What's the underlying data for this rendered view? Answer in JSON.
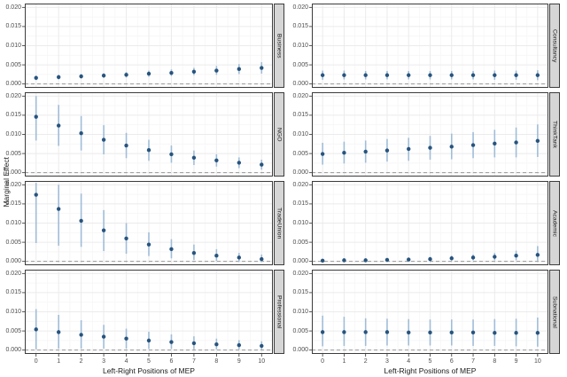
{
  "figure": {
    "y_axis_title": "Marginal Effect",
    "x_axis_title": "Left-Right Positions of MEP",
    "colors": {
      "point": "#27547e",
      "error_bar": "#a0bdd8",
      "strip_bg": "#d6d6d6",
      "panel_border": "#3c3c3c",
      "grid_major": "#ebebeb",
      "grid_minor": "#f6f6f6",
      "zero_line": "#999999",
      "tick_mark": "#333333"
    }
  },
  "chart_data": {
    "type": "scatter",
    "title": "",
    "xlabel": "Left-Right Positions of MEP",
    "ylabel": "Marginal Effect",
    "x": [
      0,
      1,
      2,
      3,
      4,
      5,
      6,
      7,
      8,
      9,
      10
    ],
    "x_tick_labels": [
      "0",
      "1",
      "2",
      "3",
      "4",
      "5",
      "6",
      "7",
      "8",
      "9",
      "10"
    ],
    "xlim": [
      -0.5,
      10.5
    ],
    "ylim": [
      -0.001,
      0.021
    ],
    "y_ticks": [
      0.0,
      0.005,
      0.01,
      0.015,
      0.02
    ],
    "y_tick_labels": [
      "0.000",
      "0.005",
      "0.010",
      "0.015",
      "0.020"
    ],
    "y_minor_ticks": [
      0.0025,
      0.0075,
      0.0125,
      0.0175
    ],
    "zero_line": 0,
    "grid": true,
    "legend": "none",
    "layout": "facet-grid 4 rows x 2 cols, strip labels on right of each panel",
    "facets": [
      {
        "name": "Business",
        "row": 0,
        "col": 0,
        "est": [
          0.0016,
          0.0018,
          0.002,
          0.0022,
          0.0024,
          0.0027,
          0.0029,
          0.0032,
          0.0035,
          0.0039,
          0.0042
        ],
        "lo": [
          0.001,
          0.0012,
          0.0014,
          0.0016,
          0.0017,
          0.0019,
          0.0021,
          0.0023,
          0.0024,
          0.0026,
          0.0027
        ],
        "hi": [
          0.0022,
          0.0024,
          0.0026,
          0.0028,
          0.0031,
          0.0035,
          0.0038,
          0.0042,
          0.0047,
          0.0052,
          0.0057
        ]
      },
      {
        "name": "Consultancy",
        "row": 0,
        "col": 1,
        "est": [
          0.0023,
          0.0023,
          0.0023,
          0.0023,
          0.0023,
          0.0023,
          0.0023,
          0.0023,
          0.0023,
          0.0023,
          0.0023
        ],
        "lo": [
          0.0011,
          0.0012,
          0.0012,
          0.0012,
          0.0012,
          0.0012,
          0.0012,
          0.0012,
          0.0011,
          0.0011,
          0.001
        ],
        "hi": [
          0.0035,
          0.0035,
          0.0034,
          0.0034,
          0.0034,
          0.0034,
          0.0034,
          0.0034,
          0.0035,
          0.0035,
          0.0036
        ]
      },
      {
        "name": "NGO",
        "row": 1,
        "col": 0,
        "est": [
          0.0146,
          0.0123,
          0.0103,
          0.0086,
          0.0071,
          0.0059,
          0.0048,
          0.0039,
          0.0032,
          0.0026,
          0.0021
        ],
        "lo": [
          0.0084,
          0.007,
          0.0058,
          0.0048,
          0.0038,
          0.0031,
          0.0026,
          0.002,
          0.0016,
          0.0012,
          0.0008
        ],
        "hi": [
          0.02,
          0.0177,
          0.0148,
          0.0124,
          0.0104,
          0.0086,
          0.0071,
          0.0058,
          0.0048,
          0.004,
          0.0034
        ]
      },
      {
        "name": "ThinkTank",
        "row": 1,
        "col": 1,
        "est": [
          0.0049,
          0.0052,
          0.0055,
          0.0058,
          0.0062,
          0.0065,
          0.0068,
          0.0072,
          0.0076,
          0.0079,
          0.0083
        ],
        "lo": [
          0.0021,
          0.0024,
          0.0026,
          0.0029,
          0.0031,
          0.0034,
          0.0035,
          0.0038,
          0.004,
          0.004,
          0.0041
        ],
        "hi": [
          0.0078,
          0.0081,
          0.0084,
          0.0088,
          0.0091,
          0.0096,
          0.0102,
          0.0106,
          0.0112,
          0.0118,
          0.0126
        ]
      },
      {
        "name": "TradeUnion",
        "row": 2,
        "col": 0,
        "est": [
          0.0174,
          0.0137,
          0.0106,
          0.0081,
          0.006,
          0.0044,
          0.0032,
          0.0022,
          0.0015,
          0.001,
          0.0006
        ],
        "lo": [
          0.0048,
          0.0041,
          0.0038,
          0.0027,
          0.002,
          0.0014,
          0.0008,
          0.0004,
          0.0001,
          0.0,
          -0.0001
        ],
        "hi": [
          0.0205,
          0.02,
          0.0177,
          0.0134,
          0.01,
          0.0076,
          0.0058,
          0.0044,
          0.0032,
          0.0022,
          0.0018
        ]
      },
      {
        "name": "Academic",
        "row": 2,
        "col": 1,
        "est": [
          0.0002,
          0.0003,
          0.0003,
          0.0004,
          0.0005,
          0.0006,
          0.0008,
          0.001,
          0.0012,
          0.0015,
          0.0017
        ],
        "lo": [
          0.0,
          0.0001,
          0.0001,
          0.0001,
          0.0001,
          0.0002,
          0.0002,
          0.0003,
          0.0003,
          0.0003,
          0.0002
        ],
        "hi": [
          0.0005,
          0.0006,
          0.0007,
          0.0008,
          0.001,
          0.0012,
          0.0015,
          0.0018,
          0.0022,
          0.0028,
          0.004
        ]
      },
      {
        "name": "Professional",
        "row": 3,
        "col": 0,
        "est": [
          0.0054,
          0.0047,
          0.004,
          0.0035,
          0.003,
          0.0025,
          0.0021,
          0.0018,
          0.0015,
          0.0013,
          0.0011
        ],
        "lo": [
          0.0002,
          0.0004,
          0.0004,
          0.0004,
          0.0004,
          0.0003,
          0.0003,
          0.0002,
          0.0002,
          0.0002,
          0.0001
        ],
        "hi": [
          0.0107,
          0.0092,
          0.0078,
          0.0066,
          0.0056,
          0.0048,
          0.0041,
          0.0036,
          0.003,
          0.0026,
          0.0023
        ]
      },
      {
        "name": "Subnational",
        "row": 3,
        "col": 1,
        "est": [
          0.0047,
          0.0047,
          0.0047,
          0.0047,
          0.0046,
          0.0046,
          0.0046,
          0.0046,
          0.0045,
          0.0045,
          0.0045
        ],
        "lo": [
          0.001,
          0.0011,
          0.0011,
          0.0012,
          0.0012,
          0.0012,
          0.0012,
          0.0011,
          0.0011,
          0.001,
          0.0009
        ],
        "hi": [
          0.009,
          0.0087,
          0.0083,
          0.0082,
          0.0081,
          0.008,
          0.008,
          0.008,
          0.0081,
          0.0082,
          0.0085
        ]
      }
    ]
  }
}
